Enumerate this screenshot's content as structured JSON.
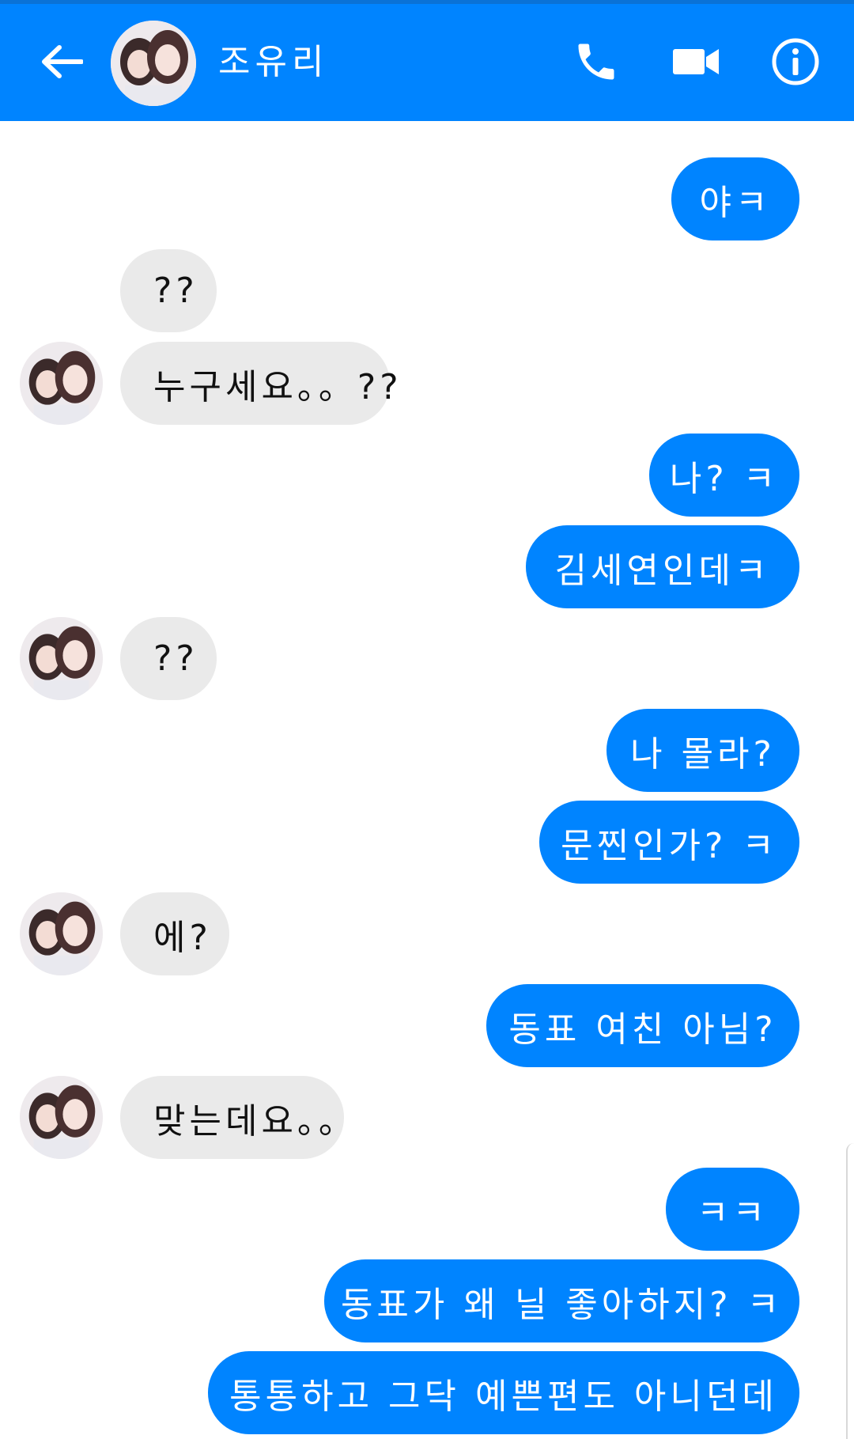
{
  "header": {
    "contact_name": "조유리",
    "back_icon": "arrow-left-icon",
    "call_icon": "phone-icon",
    "video_icon": "video-camera-icon",
    "info_icon": "info-icon",
    "bar_color": "#0084ff"
  },
  "colors": {
    "outgoing_bubble": "#0084ff",
    "incoming_bubble": "#eaeaea",
    "background": "#ffffff"
  },
  "messages": [
    {
      "side": "out",
      "text": "야ㅋ"
    },
    {
      "side": "in",
      "text": "??"
    },
    {
      "side": "in",
      "text": "누구세요。。??"
    },
    {
      "side": "out",
      "text": "나? ㅋ"
    },
    {
      "side": "out",
      "text": "김세연인데ㅋ"
    },
    {
      "side": "in",
      "text": "??"
    },
    {
      "side": "out",
      "text": "나 몰라?"
    },
    {
      "side": "out",
      "text": "문찐인가? ㅋ"
    },
    {
      "side": "in",
      "text": "에?"
    },
    {
      "side": "out",
      "text": "동표 여친 아님?"
    },
    {
      "side": "in",
      "text": "맞는데요。。"
    },
    {
      "side": "out",
      "text": "ㅋㅋ"
    },
    {
      "side": "out",
      "text": "동표가 왜 닐 좋아하지? ㅋ"
    },
    {
      "side": "out",
      "text": "통통하고 그닥 예쁜편도 아니던데"
    }
  ]
}
